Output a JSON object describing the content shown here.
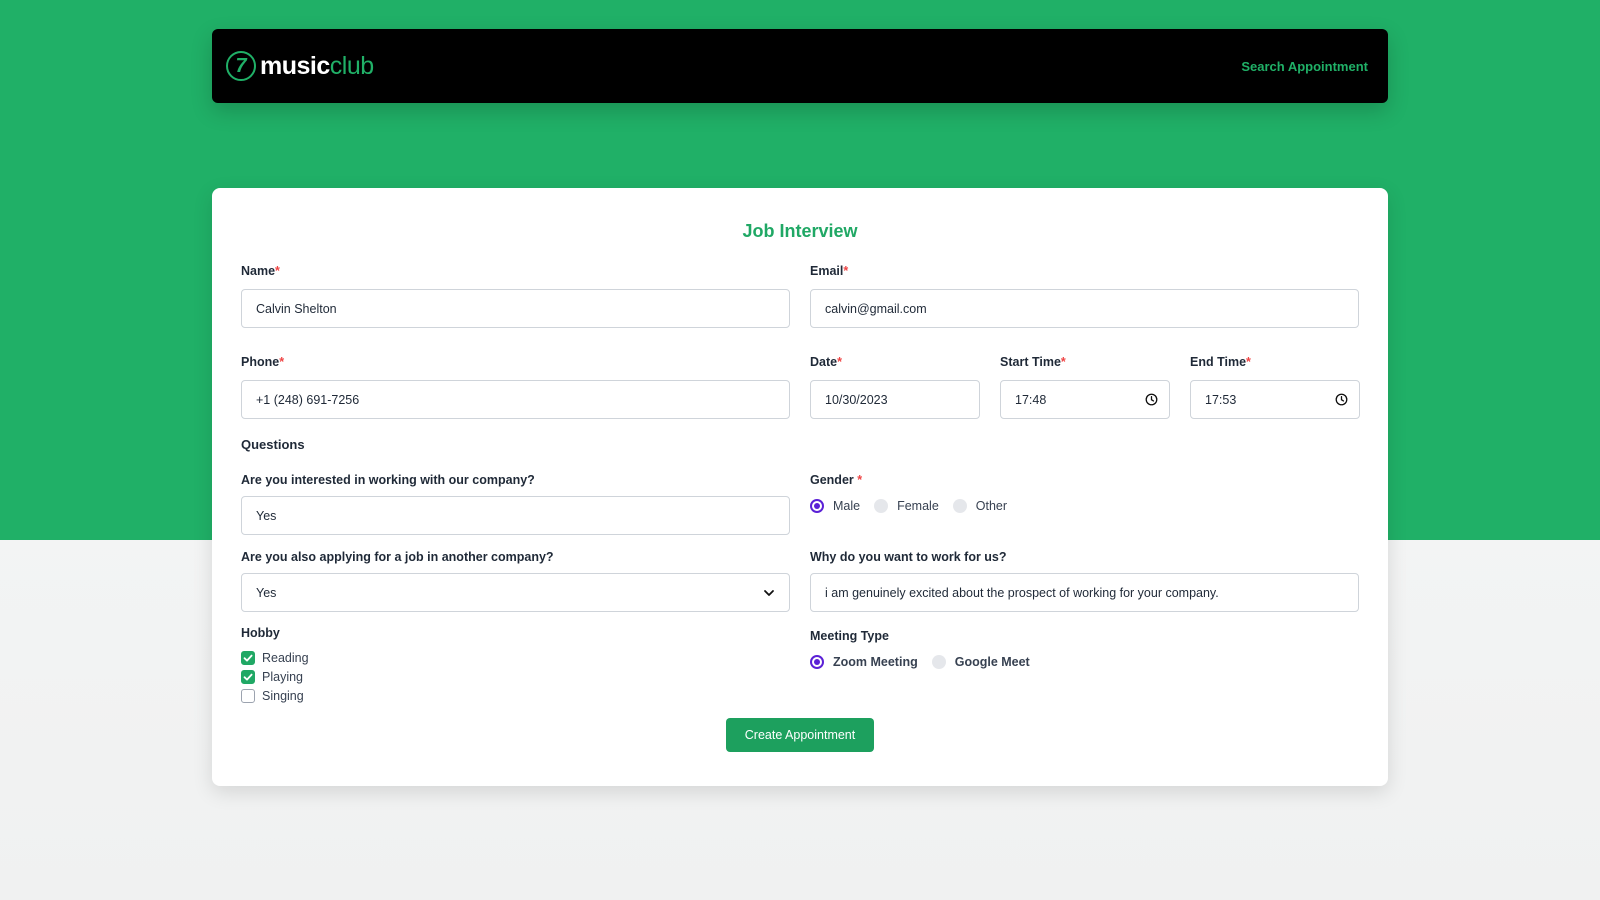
{
  "brand": {
    "logo_mark": "7",
    "name_bold": "music",
    "name_light": "club"
  },
  "nav": {
    "search_link": "Search Appointment"
  },
  "form": {
    "title": "Job Interview",
    "required_mark": "*",
    "name": {
      "label": "Name",
      "value": "Calvin Shelton"
    },
    "email": {
      "label": "Email",
      "value": "calvin@gmail.com"
    },
    "phone": {
      "label": "Phone",
      "value": "+1 (248) 691-7256"
    },
    "date": {
      "label": "Date",
      "value": "10/30/2023"
    },
    "start_time": {
      "label": "Start Time",
      "value": "17:48",
      "icon": "clock-icon"
    },
    "end_time": {
      "label": "End Time",
      "value": "17:53",
      "icon": "clock-icon"
    },
    "questions_heading": "Questions",
    "interested": {
      "label": "Are you interested in working with our company?",
      "value": "Yes"
    },
    "gender": {
      "label": "Gender",
      "options": [
        "Male",
        "Female",
        "Other"
      ],
      "selected": "Male"
    },
    "applying_elsewhere": {
      "label": "Are you also applying for a job in another company?",
      "value": "Yes",
      "icon": "chevron-down-icon"
    },
    "why_us": {
      "label": "Why do you want to work for us?",
      "value": "i am genuinely excited about the prospect of working for your company."
    },
    "hobby": {
      "label": "Hobby",
      "options": [
        {
          "label": "Reading",
          "checked": true
        },
        {
          "label": "Playing",
          "checked": true
        },
        {
          "label": "Singing",
          "checked": false
        }
      ]
    },
    "meeting_type": {
      "label": "Meeting Type",
      "options": [
        "Zoom Meeting",
        "Google Meet"
      ],
      "selected": "Zoom Meeting"
    },
    "submit_label": "Create Appointment"
  },
  "colors": {
    "brand_green": "#20b067",
    "radio_purple": "#5b21d6",
    "required_red": "#ef4444"
  }
}
